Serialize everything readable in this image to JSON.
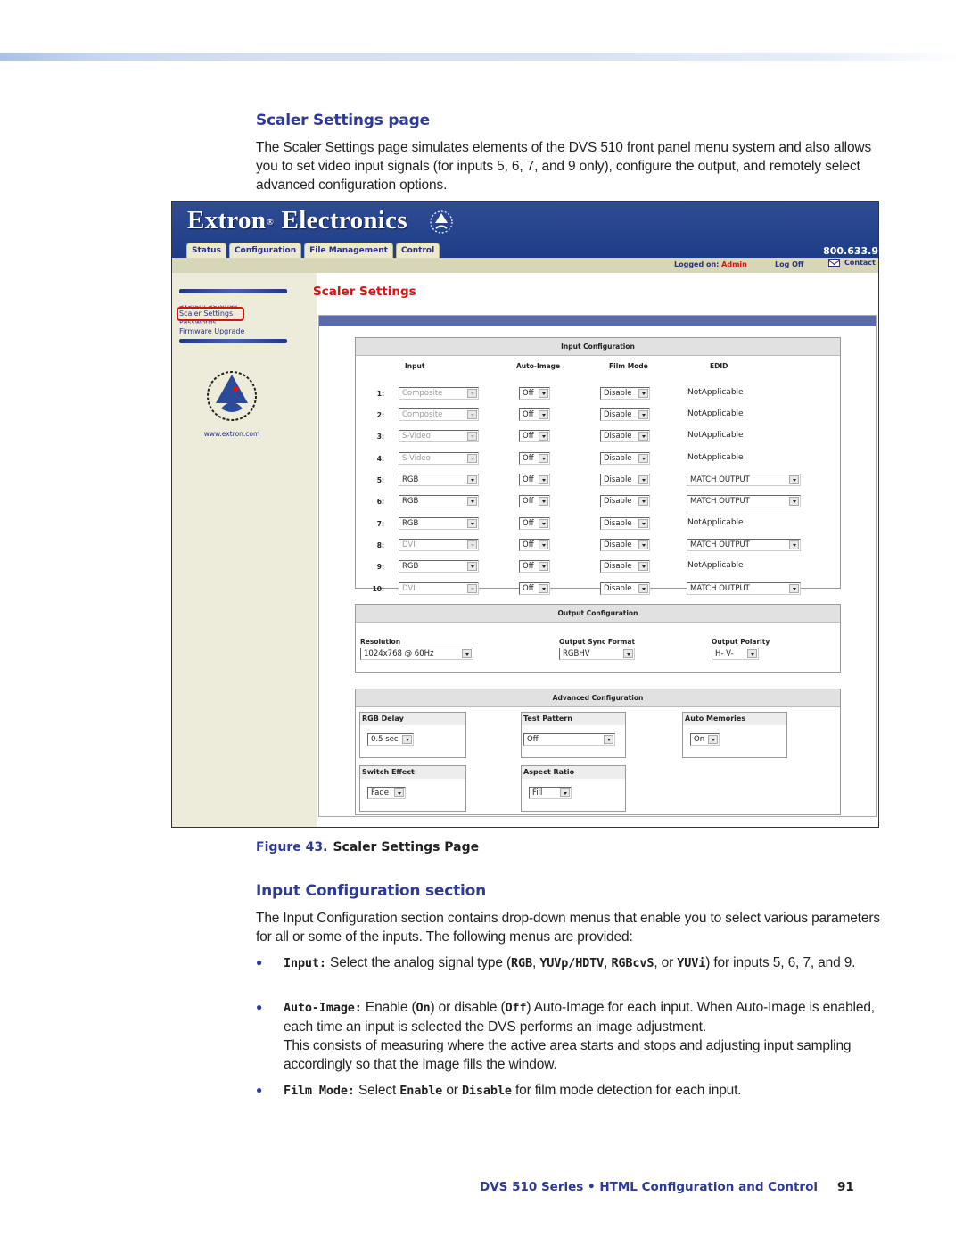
{
  "doc": {
    "section_heading": "Scaler Settings page",
    "intro_paragraph": "The Scaler Settings page simulates elements of the DVS 510 front panel menu system and also allows you to set video input signals (for inputs 5, 6, 7, and 9 only), configure the output, and remotely select advanced configuration options.",
    "figure_label": "Figure 43.",
    "figure_caption": "Scaler Settings Page",
    "subsection_heading": "Input Configuration section",
    "subsection_paragraph": "The Input Configuration section contains drop-down menus that enable you to select various parameters for all or some of the inputs. The following menus are provided:",
    "bullets": [
      {
        "term": "Input:",
        "parts": [
          " Select the analog signal type (",
          "RGB",
          ", ",
          "YUVp/HDTV",
          ", ",
          "RGBcvS",
          ", or ",
          "YUVi",
          ") for inputs 5, 6, 7, and 9."
        ]
      },
      {
        "term": "Auto-Image:",
        "parts": [
          " Enable (",
          "On",
          ") or disable (",
          "Off",
          ") Auto-Image for each input. When Auto-Image is enabled, each time an input is selected the DVS performs an image adjustment."
        ],
        "continuation": "This consists of measuring where the active area starts and stops and adjusting input sampling accordingly so that the image fills the window."
      },
      {
        "term": "Film Mode:",
        "parts": [
          " Select ",
          "Enable",
          " or ",
          "Disable",
          " for film mode detection for each input."
        ]
      }
    ],
    "footer_title": "DVS 510 Series • HTML Configuration and Control",
    "page_number": "91"
  },
  "app": {
    "brand": "Extron",
    "brand_reg": "®",
    "brand_suffix": "Electronics",
    "tabs": [
      {
        "label": "Status",
        "active": false
      },
      {
        "label": "Configuration",
        "active": true
      },
      {
        "label": "File Management",
        "active": false
      },
      {
        "label": "Control",
        "active": false
      }
    ],
    "phone": "800.633.9",
    "logged_on_label": "Logged on:",
    "logged_on_user": "Admin",
    "log_off": "Log Off",
    "contact": "Contact",
    "sidebar": {
      "items": [
        "System Settings",
        "Scaler Settings",
        "Passwords",
        "Firmware Upgrade"
      ],
      "selected": "Scaler Settings",
      "url": "www.extron.com"
    },
    "page_title": "Scaler Settings",
    "input_config": {
      "title": "Input Configuration",
      "headers": [
        "Input",
        "Auto-Image",
        "Film Mode",
        "EDID"
      ],
      "rows": [
        {
          "num": "1:",
          "input": "Composite",
          "input_disabled": true,
          "auto_image": "Off",
          "film_mode": "Disable",
          "edid": "NotApplicable",
          "edid_select": false
        },
        {
          "num": "2:",
          "input": "Composite",
          "input_disabled": true,
          "auto_image": "Off",
          "film_mode": "Disable",
          "edid": "NotApplicable",
          "edid_select": false
        },
        {
          "num": "3:",
          "input": "S-Video",
          "input_disabled": true,
          "auto_image": "Off",
          "film_mode": "Disable",
          "edid": "NotApplicable",
          "edid_select": false
        },
        {
          "num": "4:",
          "input": "S-Video",
          "input_disabled": true,
          "auto_image": "Off",
          "film_mode": "Disable",
          "edid": "NotApplicable",
          "edid_select": false
        },
        {
          "num": "5:",
          "input": "RGB",
          "input_disabled": false,
          "auto_image": "Off",
          "film_mode": "Disable",
          "edid": "MATCH OUTPUT",
          "edid_select": true
        },
        {
          "num": "6:",
          "input": "RGB",
          "input_disabled": false,
          "auto_image": "Off",
          "film_mode": "Disable",
          "edid": "MATCH OUTPUT",
          "edid_select": true
        },
        {
          "num": "7:",
          "input": "RGB",
          "input_disabled": false,
          "auto_image": "Off",
          "film_mode": "Disable",
          "edid": "NotApplicable",
          "edid_select": false
        },
        {
          "num": "8:",
          "input": "DVI",
          "input_disabled": true,
          "auto_image": "Off",
          "film_mode": "Disable",
          "edid": "MATCH OUTPUT",
          "edid_select": true
        },
        {
          "num": "9:",
          "input": "RGB",
          "input_disabled": false,
          "auto_image": "Off",
          "film_mode": "Disable",
          "edid": "NotApplicable",
          "edid_select": false
        },
        {
          "num": "10:",
          "input": "DVI",
          "input_disabled": true,
          "auto_image": "Off",
          "film_mode": "Disable",
          "edid": "MATCH OUTPUT",
          "edid_select": true
        }
      ]
    },
    "output_config": {
      "title": "Output Configuration",
      "resolution_label": "Resolution",
      "resolution": "1024x768 @ 60Hz",
      "sync_label": "Output Sync Format",
      "sync": "RGBHV",
      "polarity_label": "Output Polarity",
      "polarity": "H- V-"
    },
    "advanced_config": {
      "title": "Advanced Configuration",
      "rgb_delay_label": "RGB Delay",
      "rgb_delay": "0.5 sec",
      "test_pattern_label": "Test Pattern",
      "test_pattern": "Off",
      "auto_memories_label": "Auto Memories",
      "auto_memories": "On",
      "switch_effect_label": "Switch Effect",
      "switch_effect": "Fade",
      "aspect_ratio_label": "Aspect Ratio",
      "aspect_ratio": "Fill"
    },
    "colors": {
      "header_blue": "#1e3d88",
      "accent_red": "#e01010",
      "link_blue": "#27318a",
      "doc_heading_blue": "#2e3a95"
    }
  }
}
